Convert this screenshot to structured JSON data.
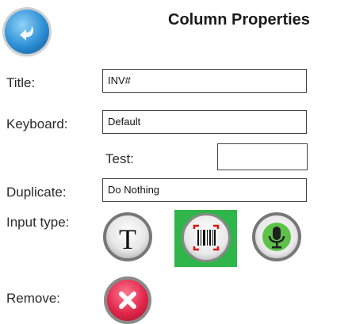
{
  "header": {
    "title": "Column Properties",
    "back_icon": "back-arrow-icon"
  },
  "form": {
    "title_label": "Title:",
    "title_value": "INV#",
    "keyboard_label": "Keyboard:",
    "keyboard_value": "Default",
    "test_label": "Test:",
    "test_value": "",
    "duplicate_label": "Duplicate:",
    "duplicate_value": "Do Nothing",
    "input_type_label": "Input type:",
    "remove_label": "Remove:"
  },
  "input_types": {
    "text_glyph": "T",
    "text_icon": "text-type-icon",
    "barcode_icon": "barcode-scan-icon",
    "microphone_icon": "microphone-icon",
    "selected": "barcode",
    "selected_color": "#30b54b"
  },
  "remove": {
    "icon": "remove-x-icon",
    "color": "#e0274a"
  }
}
